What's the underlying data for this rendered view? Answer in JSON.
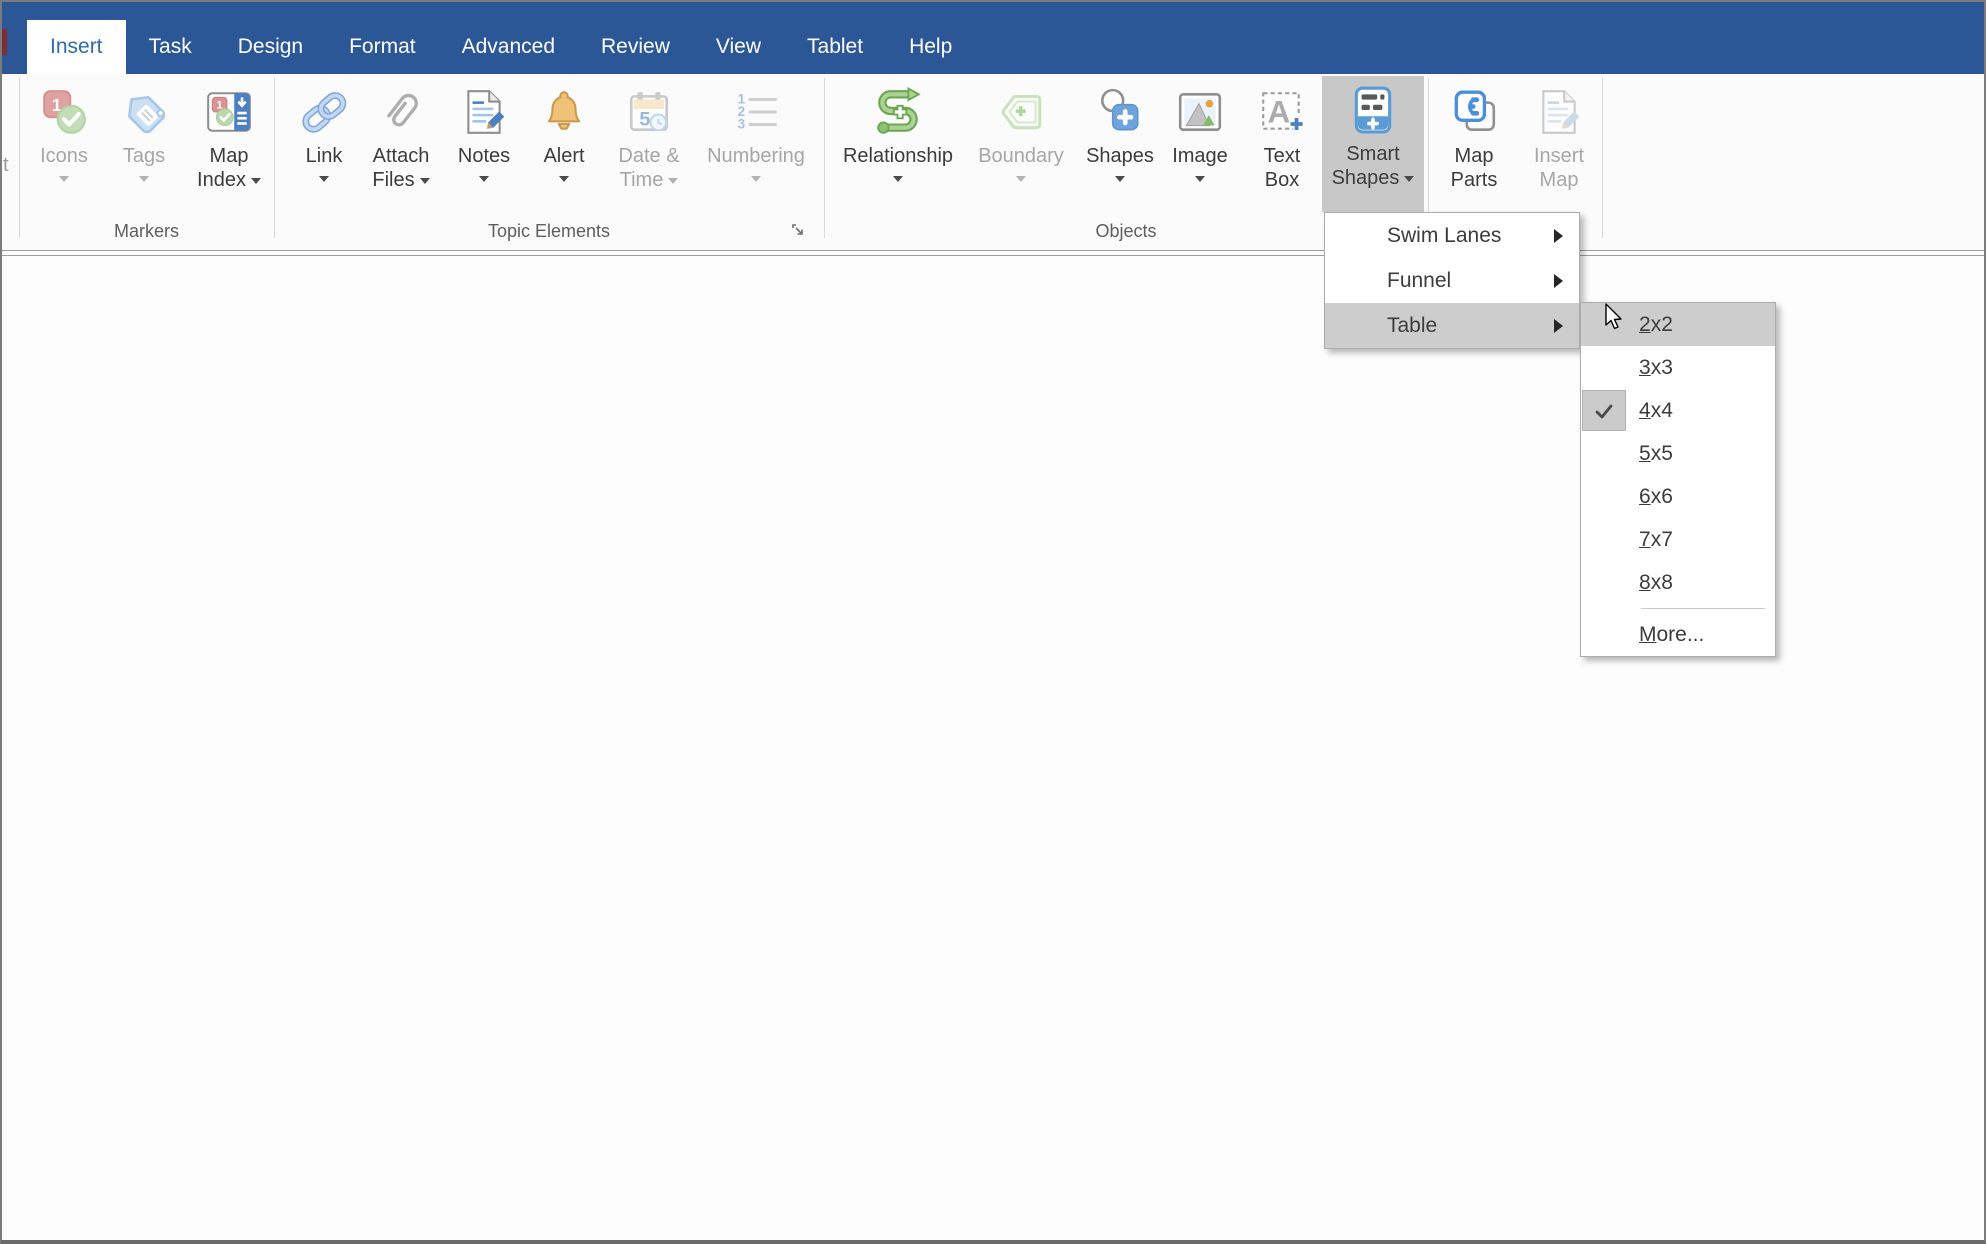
{
  "menubar": {
    "tabs": [
      {
        "label": "Insert",
        "active": true
      },
      {
        "label": "Task"
      },
      {
        "label": "Design"
      },
      {
        "label": "Format"
      },
      {
        "label": "Advanced"
      },
      {
        "label": "Review"
      },
      {
        "label": "View"
      },
      {
        "label": "Tablet"
      },
      {
        "label": "Help"
      }
    ]
  },
  "ribbon": {
    "clipped_left_text": "t",
    "groups": [
      {
        "label": "Markers",
        "buttons": [
          {
            "line1": "Icons",
            "line2": "",
            "disabled": true
          },
          {
            "line1": "Tags",
            "line2": "",
            "disabled": true
          },
          {
            "line1": "Map",
            "line2": "Index",
            "disabled": false
          }
        ]
      },
      {
        "label": "Topic Elements",
        "buttons": [
          {
            "line1": "Link",
            "line2": ""
          },
          {
            "line1": "Attach",
            "line2": "Files"
          },
          {
            "line1": "Notes",
            "line2": ""
          },
          {
            "line1": "Alert",
            "line2": ""
          },
          {
            "line1": "Date &",
            "line2": "Time",
            "disabled": true
          },
          {
            "line1": "Numbering",
            "line2": "",
            "disabled": true
          }
        ]
      },
      {
        "label": "Objects",
        "buttons": [
          {
            "line1": "Relationship",
            "line2": ""
          },
          {
            "line1": "Boundary",
            "line2": "",
            "disabled": true
          },
          {
            "line1": "Shapes",
            "line2": ""
          },
          {
            "line1": "Image",
            "line2": ""
          },
          {
            "line1": "Text",
            "line2": "Box"
          },
          {
            "line1": "Smart",
            "line2": "Shapes",
            "active": true
          }
        ]
      },
      {
        "label": "",
        "buttons": [
          {
            "line1": "Map",
            "line2": "Parts"
          },
          {
            "line1": "Insert",
            "line2": "Map",
            "disabled": true
          }
        ]
      }
    ]
  },
  "smart_shapes_menu": {
    "items": [
      {
        "label": "Swim Lanes",
        "has_submenu": true
      },
      {
        "label": "Funnel",
        "has_submenu": true
      },
      {
        "label": "Table",
        "has_submenu": true,
        "highlighted": true
      }
    ]
  },
  "table_submenu": {
    "items": [
      {
        "accel": "2",
        "rest": "x2",
        "highlighted": true
      },
      {
        "accel": "3",
        "rest": "x3"
      },
      {
        "accel": "4",
        "rest": "x4",
        "checked": true
      },
      {
        "accel": "5",
        "rest": "x5"
      },
      {
        "accel": "6",
        "rest": "x6"
      },
      {
        "accel": "7",
        "rest": "x7"
      },
      {
        "accel": "8",
        "rest": "x8"
      },
      {
        "accel": "M",
        "rest": "ore...",
        "separator_before": true
      }
    ]
  },
  "colors": {
    "menubar_blue": "#2B5797",
    "active_tab_text": "#2E6DA8",
    "ribbon_button_highlight": "#C8C8C8",
    "menu_highlight": "#CDCDCD"
  }
}
